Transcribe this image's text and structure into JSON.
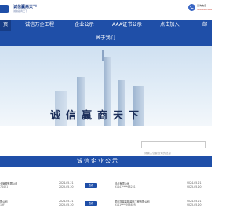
{
  "header": {
    "logo_cn": "诚信赢商天下",
    "logo_en": "诚信赢商天下",
    "phone_line1": "咨询电话",
    "phone_line2": "400-000-0000",
    "brand_color": "#1f4fa8"
  },
  "nav": {
    "items": [
      {
        "label": "页",
        "active": true
      },
      {
        "label": "诚信万企工程"
      },
      {
        "label": "企业公示"
      },
      {
        "label": "AAA证书公示"
      },
      {
        "label": "点击加入"
      },
      {
        "label": "邮"
      },
      {
        "label": "关于我们"
      }
    ]
  },
  "banner": {
    "title": "诚信赢商天下"
  },
  "search": {
    "placeholder": "请输入您要查询的信息"
  },
  "section": {
    "title": "诚信企业公示"
  },
  "list": {
    "rows": [
      {
        "name": "业管理有限公司",
        "code": "74421",
        "date1": "2024-05-21",
        "date2": "2025-05-20",
        "button": "查看"
      },
      {
        "name": "技术有限公司",
        "code": "91441****68231",
        "date1": "2024-05-21",
        "date2": "2025-05-20",
        "button": "查看"
      },
      {
        "name": "限公司",
        "code": "19F",
        "date1": "2024-05-21",
        "date2": "2025-05-20",
        "button": "查看"
      },
      {
        "name": "重庆凯瑞建筑装饰工程有限公司",
        "code": "9141****95862R",
        "date1": "2024-05-21",
        "date2": "2025-05-20",
        "button": "查看"
      }
    ]
  }
}
